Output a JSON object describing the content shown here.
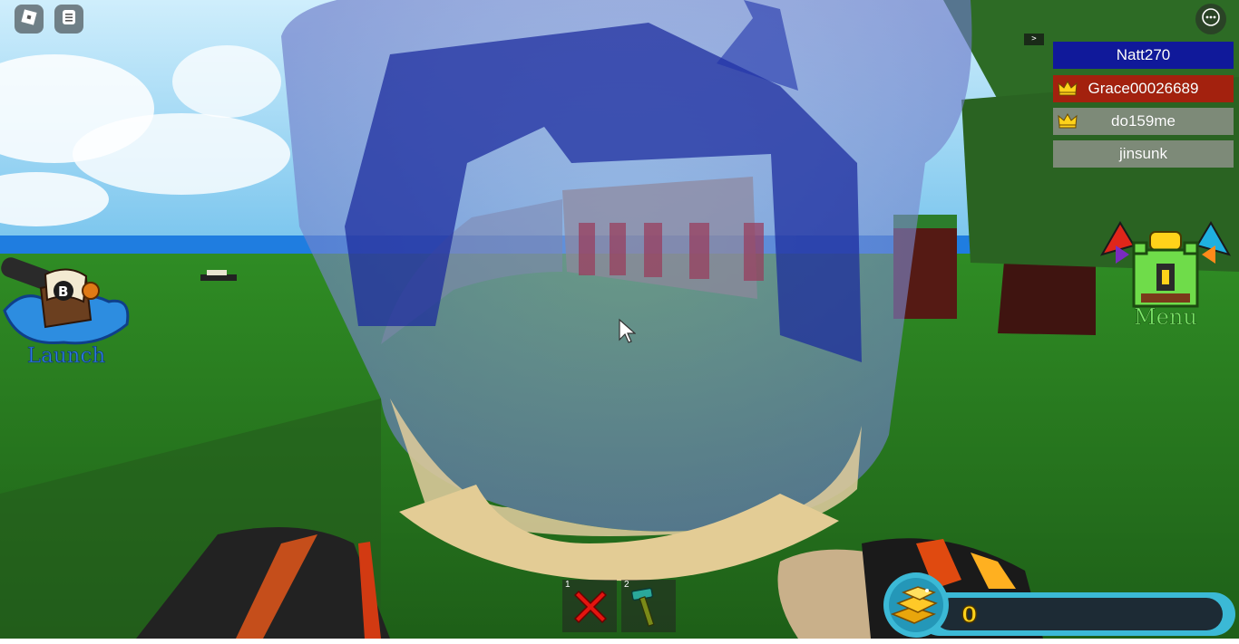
{
  "top_bar": {
    "roblox_menu_icon": "roblox-logo-icon",
    "chat_icon": "chat-icon",
    "more_icon": "more-options-icon"
  },
  "leaderboard": {
    "toggle_label": ">",
    "players": [
      {
        "name": "Natt270",
        "crown": false,
        "color": "#10199a"
      },
      {
        "name": "Grace00026689",
        "crown": true,
        "color": "#a3210e"
      },
      {
        "name": "do159me",
        "crown": true,
        "color": "#7d8a78"
      },
      {
        "name": "jinsunk",
        "crown": false,
        "color": "#7d8a78"
      }
    ]
  },
  "left_hud": {
    "launch_label": "Launch",
    "launch_icon": "boat-cannon-icon"
  },
  "right_hud": {
    "menu_label": "Menu",
    "menu_icon": "castle-menu-icon"
  },
  "hotbar": {
    "slots": [
      {
        "number": "1",
        "icon": "red-x-icon"
      },
      {
        "number": "2",
        "icon": "hammer-icon"
      }
    ]
  },
  "currency": {
    "value": "0",
    "icon": "gold-bars-icon",
    "accent": "#3bb9d6"
  }
}
